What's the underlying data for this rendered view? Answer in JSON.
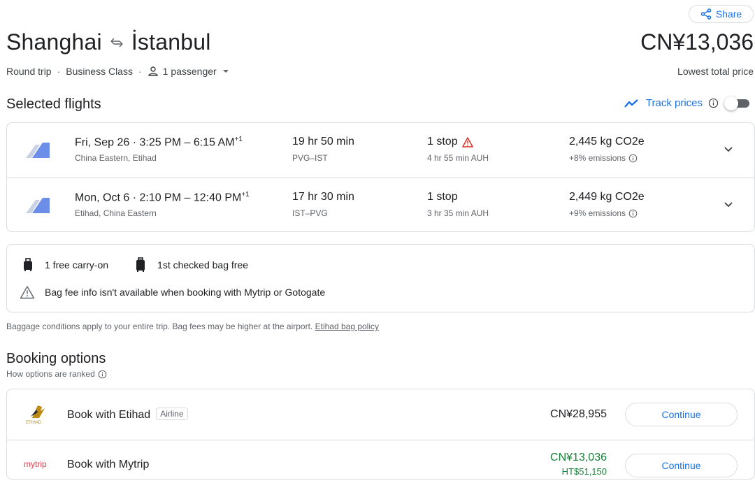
{
  "header": {
    "share_label": "Share",
    "origin": "Shanghai",
    "destination": "İstanbul",
    "trip_type": "Round trip",
    "cabin": "Business Class",
    "passengers": "1 passenger",
    "price": "CN¥13,036",
    "price_label": "Lowest total price"
  },
  "selected": {
    "title": "Selected flights",
    "track_label": "Track prices",
    "flights": [
      {
        "date_time": "Fri, Sep 26 · 3:25 PM – 6:15 AM",
        "day_offset": "+1",
        "airlines": "China Eastern, Etihad",
        "duration": "19 hr 50 min",
        "route": "PVG–IST",
        "stops": "1 stop",
        "layover": "4 hr 55 min AUH",
        "co2": "2,445 kg CO2e",
        "emissions": "+8% emissions"
      },
      {
        "date_time": "Mon, Oct 6 · 2:10 PM – 12:40 PM",
        "day_offset": "+1",
        "airlines": "Etihad, China Eastern",
        "duration": "17 hr 30 min",
        "route": "IST–PVG",
        "stops": "1 stop",
        "layover": "3 hr 35 min AUH",
        "co2": "2,449 kg CO2e",
        "emissions": "+9% emissions"
      }
    ]
  },
  "baggage": {
    "carry_on": "1 free carry-on",
    "checked": "1st checked bag free",
    "warning": "Bag fee info isn't available when booking with Mytrip or Gotogate",
    "note": "Baggage conditions apply to your entire trip. Bag fees may be higher at the airport.",
    "policy_link": "Etihad bag policy"
  },
  "booking": {
    "title": "Booking options",
    "ranked_label": "How options are ranked",
    "options": [
      {
        "logo_text": "ETIHAD",
        "name": "Book with Etihad",
        "badge": "Airline",
        "price": "CN¥28,955",
        "button": "Continue"
      },
      {
        "logo_text": "mytrip",
        "name": "Book with Mytrip",
        "price": "CN¥13,036",
        "price_sub": "HT$51,150",
        "button": "Continue"
      }
    ]
  },
  "colors": {
    "accent": "#1a73e8",
    "warning": "#d93025",
    "price_green": "#188038",
    "mytrip_red": "#e5384a"
  }
}
